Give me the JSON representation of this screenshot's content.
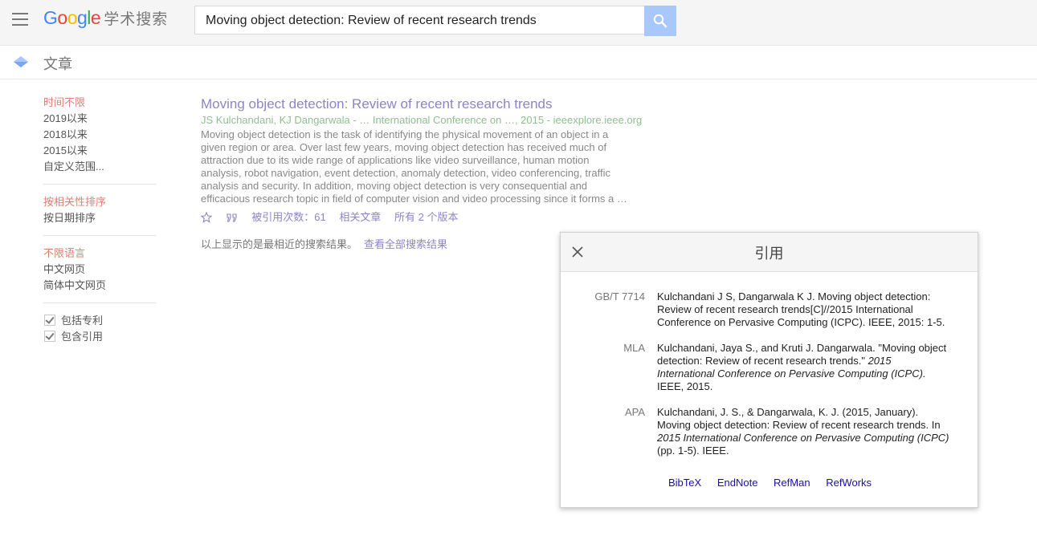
{
  "header": {
    "logo_letters": [
      "G",
      "o",
      "o",
      "g",
      "l",
      "e"
    ],
    "logo_suffix": "学术搜索",
    "search_query": "Moving object detection: Review of recent research trends"
  },
  "subheader": {
    "title": "文章"
  },
  "sidebar": {
    "time": [
      "时间不限",
      "2019以来",
      "2018以来",
      "2015以来",
      "自定义范围..."
    ],
    "sort": [
      "按相关性排序",
      "按日期排序"
    ],
    "language": [
      "不限语言",
      "中文网页",
      "简体中文网页"
    ],
    "checks": [
      "包括专利",
      "包含引用"
    ]
  },
  "result": {
    "title": "Moving object detection: Review of recent research trends",
    "authors": "JS Kulchandani, KJ Dangarwala - … International Conference on …, 2015 - ieeexplore.ieee.org",
    "snippet": "Moving object detection is the task of identifying the physical movement of an object in a given region or area. Over last few years, moving object detection has received much of attraction due to its wide range of applications like video surveillance, human motion analysis, robot navigation, event detection, anomaly detection, video conferencing, traffic analysis and security. In addition, moving object detection is very consequential and efficacious research topic in field of computer vision and video processing since it forms a …",
    "cited_by": "被引用次数：61",
    "related": "相关文章",
    "versions": "所有 2 个版本"
  },
  "note": {
    "text": "以上显示的是最相近的搜索结果。",
    "link": "查看全部搜索结果"
  },
  "cite_dialog": {
    "title": "引用",
    "entries": [
      {
        "label": "GB/T 7714",
        "text": "Kulchandani J S, Dangarwala K J. Moving object detection: Review of recent research trends[C]//2015 International Conference on Pervasive Computing (ICPC). IEEE, 2015: 1-5."
      },
      {
        "label": "MLA",
        "pre": "Kulchandani, Jaya S., and Kruti J. Dangarwala. \"Moving object detection: Review of recent research trends.\" ",
        "italic": "2015 International Conference on Pervasive Computing (ICPC).",
        "post": " IEEE, 2015."
      },
      {
        "label": "APA",
        "pre": "Kulchandani, J. S., & Dangarwala, K. J. (2015, January). Moving object detection: Review of recent research trends. In ",
        "italic": "2015 International Conference on Pervasive Computing (ICPC)",
        "post": " (pp. 1-5). IEEE."
      }
    ],
    "links": [
      "BibTeX",
      "EndNote",
      "RefMan",
      "RefWorks"
    ]
  },
  "colors": {
    "accent": "#8e84c6",
    "search_button": "#a8c7fa",
    "green_link": "#8fbf8f",
    "active_filter": "#d14836"
  }
}
